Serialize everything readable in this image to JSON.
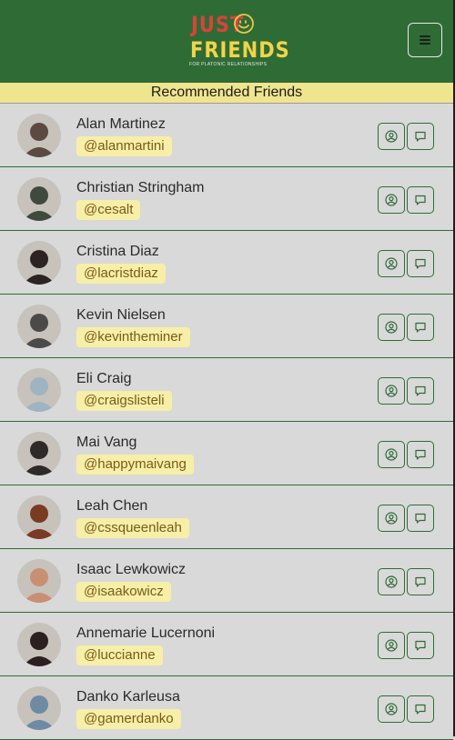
{
  "header": {
    "logo_top": "JUST",
    "logo_bottom": "FRIENDS",
    "tagline": "FOR PLATONIC RELATIONSHIPS",
    "menu_icon": "hamburger-icon"
  },
  "section_title": "Recommended Friends",
  "colors": {
    "header_bg": "#2f6b35",
    "logo_red": "#d9433b",
    "logo_yellow": "#f2d44a",
    "banner_bg": "#efe58e",
    "handle_bg": "#f7efa8",
    "row_bg": "#d9d9d9"
  },
  "friends": [
    {
      "name": "Alan Martinez",
      "handle": "@alanmartini",
      "avatar_color": "#5b4a42"
    },
    {
      "name": "Christian Stringham",
      "handle": "@cesalt",
      "avatar_color": "#3f4a3f"
    },
    {
      "name": "Cristina Diaz",
      "handle": "@lacristdiaz",
      "avatar_color": "#2b2422"
    },
    {
      "name": "Kevin Nielsen",
      "handle": "@kevintheminer",
      "avatar_color": "#4a4a4a"
    },
    {
      "name": "Eli Craig",
      "handle": "@craigslisteli",
      "avatar_color": "#9fb4c2"
    },
    {
      "name": "Mai Vang",
      "handle": "@happymaivang",
      "avatar_color": "#2f2a2a"
    },
    {
      "name": "Leah Chen",
      "handle": "@cssqueenleah",
      "avatar_color": "#7a3b22"
    },
    {
      "name": "Isaac Lewkowicz",
      "handle": "@isaakowicz",
      "avatar_color": "#c98f72"
    },
    {
      "name": "Annemarie Lucernoni",
      "handle": "@luccianne",
      "avatar_color": "#2a2020"
    },
    {
      "name": "Danko Karleusa",
      "handle": "@gamerdanko",
      "avatar_color": "#6f8aa3"
    }
  ],
  "actions": {
    "profile_icon": "profile-circle-icon",
    "message_icon": "chat-bubble-icon"
  }
}
